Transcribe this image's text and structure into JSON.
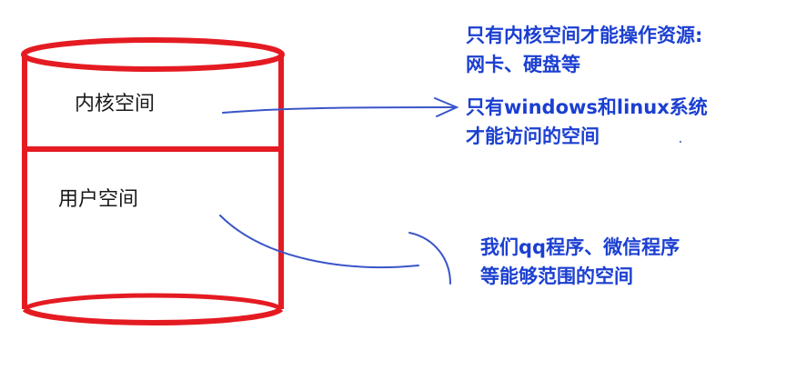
{
  "colors": {
    "cylinder": "#e51b22",
    "arrow": "#3a55c9",
    "annotation_text": "#1b3fd1",
    "label_text": "#1a1a1a"
  },
  "cylinder": {
    "kernel_label": "内核空间",
    "user_label": "用户空间"
  },
  "annotations": {
    "top_line1": "只有内核空间才能操作资源:",
    "top_line2": "网卡、硬盘等",
    "kernel_line1": "只有windows和linux系统",
    "kernel_line2": "才能访问的空间",
    "user_line1": "我们qq程序、微信程序",
    "user_line2": "等能够范围的空间"
  }
}
